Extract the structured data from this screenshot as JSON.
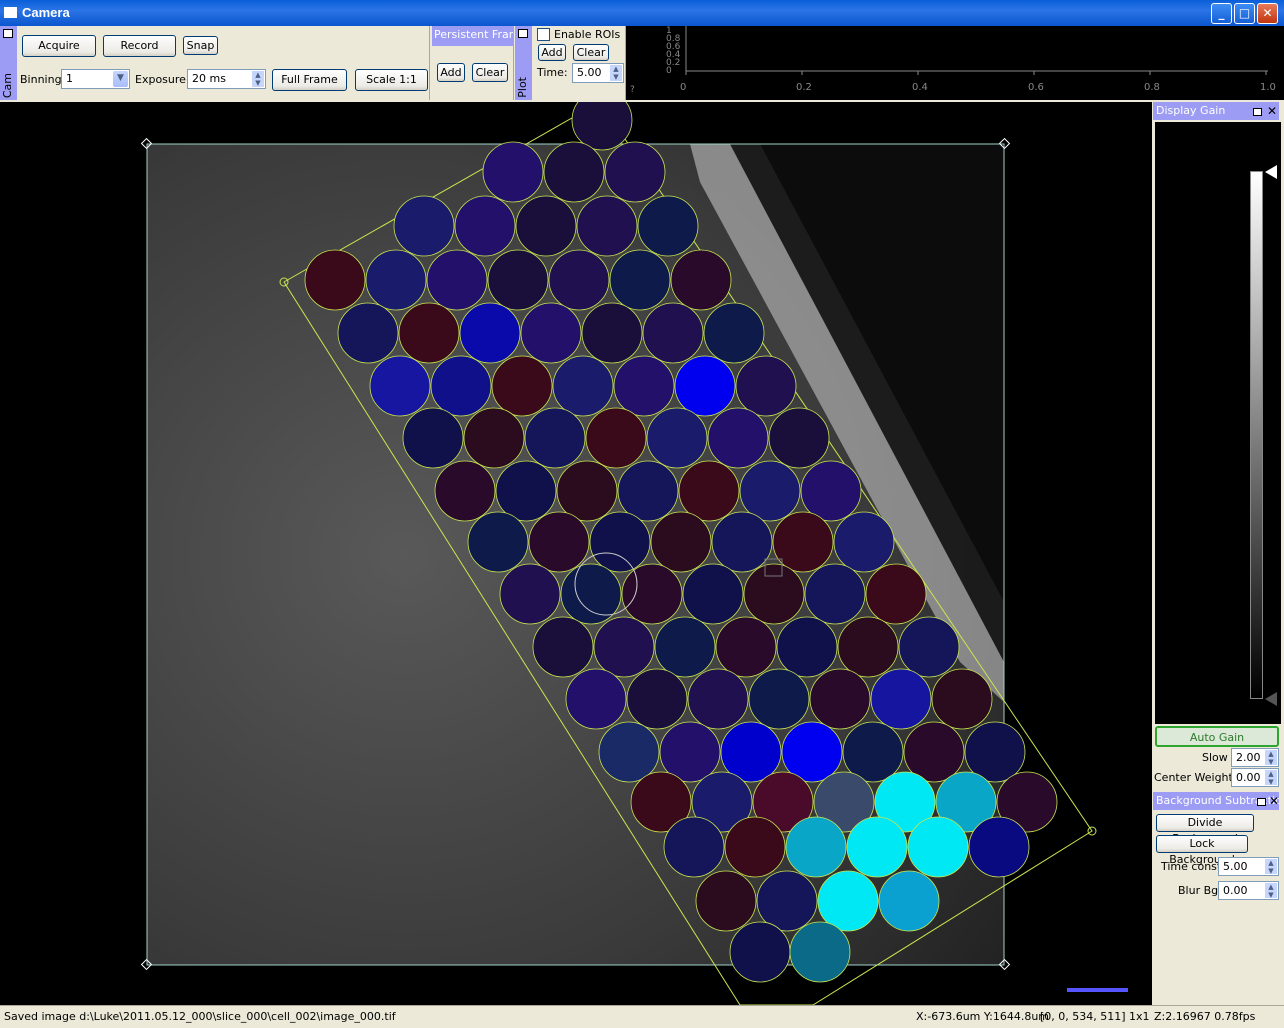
{
  "window": {
    "title": "Camera"
  },
  "camera_dock": {
    "tab_label": "Cam",
    "acquire": "Acquire",
    "record": "Record",
    "snap": "Snap",
    "binning_label": "Binning",
    "binning_value": "1",
    "exposure_label": "Exposure",
    "exposure_value": "20 ms",
    "full_frame": "Full Frame",
    "scale": "Scale 1:1"
  },
  "persistent_dock": {
    "title": "Persistent Frames",
    "add": "Add",
    "clear": "Clear"
  },
  "roi_dock": {
    "tab_label": "Plot",
    "enable_rois": "Enable ROIs",
    "add": "Add",
    "clear": "Clear",
    "time_label": "Time:",
    "time_value": "5.00"
  },
  "plot": {
    "y_ticks": [
      "1",
      "0.8",
      "0.6",
      "0.4",
      "0.2",
      "0"
    ],
    "x_ticks": [
      "0",
      "0.2",
      "0.4",
      "0.6",
      "0.8",
      "1.0"
    ],
    "y_label": "?"
  },
  "display_gain": {
    "title": "Display Gain",
    "auto_gain": "Auto Gain",
    "slow_label": "Slow",
    "slow_value": "2.00",
    "center_weight_label": "Center Weight",
    "center_weight_value": "0.00"
  },
  "background": {
    "title": "Background Subtraction",
    "divide": "Divide Background",
    "lock": "Lock Background",
    "time_const_label": "Time const.",
    "time_const_value": "5.00",
    "blur_label": "Blur Bg.",
    "blur_value": "0.00"
  },
  "status": {
    "message": "Saved image d:\\Luke\\2011.05.12_000\\slice_000\\cell_002\\image_000.tif",
    "coords": "X:-673.6um Y:1644.8um",
    "region": "[0, 0, 534, 511] 1x1",
    "zoom_fps": "Z:2.16967  0.78fps"
  },
  "roi_colors": {
    "hot": "#00e8f4",
    "mid": "#0aa6c8",
    "blue": "#2a2aee",
    "dark": "#1a0a3a"
  }
}
